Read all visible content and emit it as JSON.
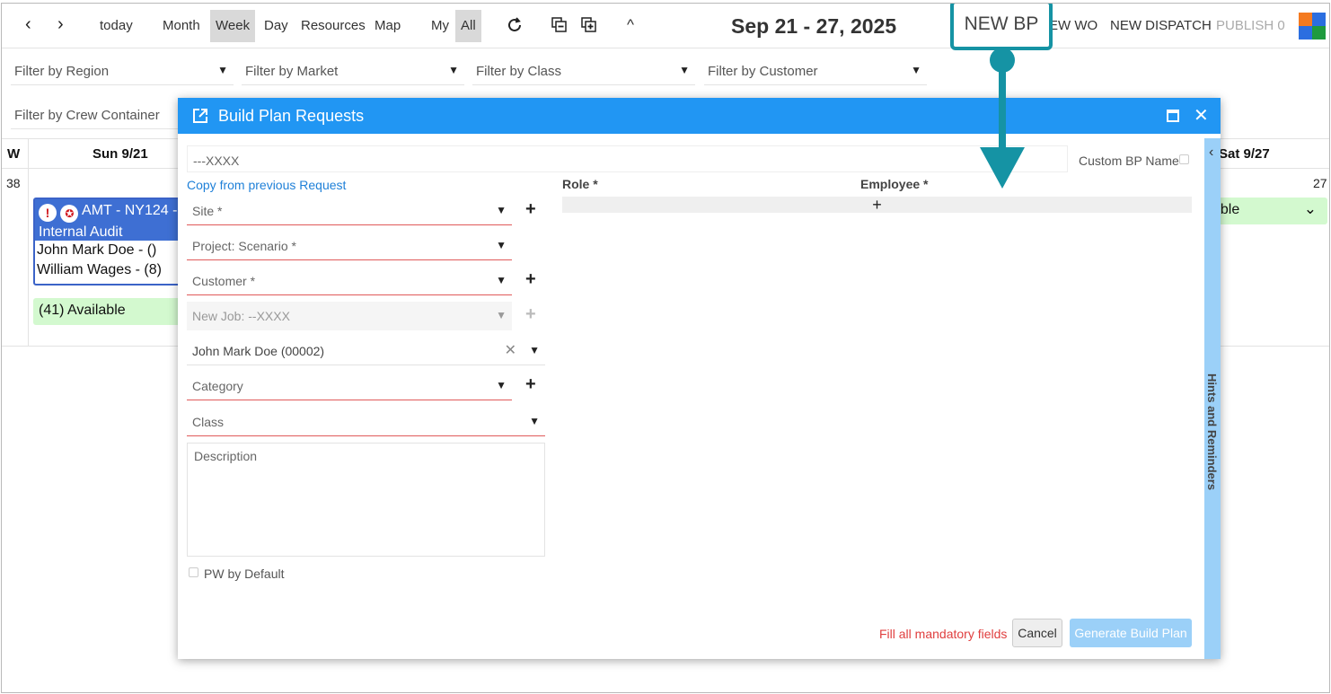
{
  "toolbar": {
    "today": "today",
    "month": "Month",
    "week": "Week",
    "day": "Day",
    "resources": "Resources",
    "map": "Map",
    "my": "My",
    "all": "All",
    "date_range": "Sep 21 - 27, 2025",
    "new_bp": "NEW BP",
    "new_wo": "EW WO",
    "new_dispatch": "NEW DISPATCH",
    "publish": "PUBLISH 0",
    "collapse_symbol": "^"
  },
  "filters": {
    "region": "Filter by Region",
    "market": "Filter by Market",
    "class": "Filter by Class",
    "customer": "Filter by Customer",
    "crew_container": "Filter by Crew Container"
  },
  "calendar": {
    "week_col": "W",
    "sun_header": "Sun 9/21",
    "sat_header": "Sat 9/27",
    "week_number": "38",
    "day_number": "27",
    "event": {
      "title": "AMT - NY124 - Internal Audit",
      "names": [
        "John Mark Doe - ()",
        "William Wages - (8)"
      ]
    },
    "available_sun": "(41) Available",
    "available_sat": "able"
  },
  "dialog": {
    "title": "Build Plan Requests",
    "bp_name_placeholder": "---XXXX",
    "custom_bp_name": "Custom BP Name",
    "copy_previous": "Copy from previous Request",
    "site": "Site *",
    "project_scenario": "Project: Scenario *",
    "customer": "Customer *",
    "new_job": "New Job: --XXXX",
    "employee_value": "John Mark Doe (00002)",
    "category": "Category",
    "class": "Class",
    "description": "Description",
    "pw_default": "PW by Default",
    "role_header": "Role *",
    "employee_header": "Employee *",
    "add_symbol": "+",
    "hints": "Hints and Reminders",
    "warning": "Fill all mandatory fields",
    "cancel": "Cancel",
    "generate": "Generate Build Plan"
  },
  "colors": {
    "dialog_header": "#2196f3",
    "annotation": "#1593a4",
    "event_blue": "#3e6fd3",
    "available_green": "#d3f9cf",
    "warning_red": "#e03e3e"
  }
}
